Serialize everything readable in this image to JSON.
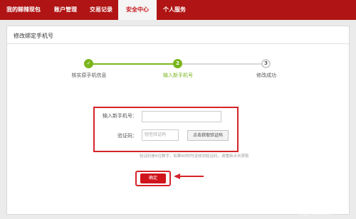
{
  "nav": {
    "tabs": [
      {
        "label": "我的睇辣现包",
        "active": false
      },
      {
        "label": "账户管理",
        "active": false
      },
      {
        "label": "交易记录",
        "active": false
      },
      {
        "label": "安全中心",
        "active": true
      },
      {
        "label": "个人服务",
        "active": false
      }
    ]
  },
  "panel": {
    "title": "修改绑定手机号"
  },
  "steps": [
    {
      "number": "✓",
      "label": "核实原手机信息",
      "state": "done"
    },
    {
      "number": "2",
      "label": "输入新手机号",
      "state": "current"
    },
    {
      "number": "3",
      "label": "修改成功",
      "state": "pending"
    }
  ],
  "form": {
    "phone_label": "输入新手机号：",
    "phone_placeholder": "",
    "code_label": "验证码：",
    "code_placeholder": "短信验证码",
    "sms_button_label": "点击获取验证码",
    "hint": "验证码是6位数字，如果60秒内没收到验证码，请重新点击获取",
    "confirm_label": "确定"
  },
  "watermark": {
    "text": "Baidu 经验",
    "subtext": "jingyan.baidu.com"
  },
  "colors": {
    "brand_red": "#b01414",
    "accent_red": "#d5242b",
    "step_green": "#7ab51d"
  }
}
